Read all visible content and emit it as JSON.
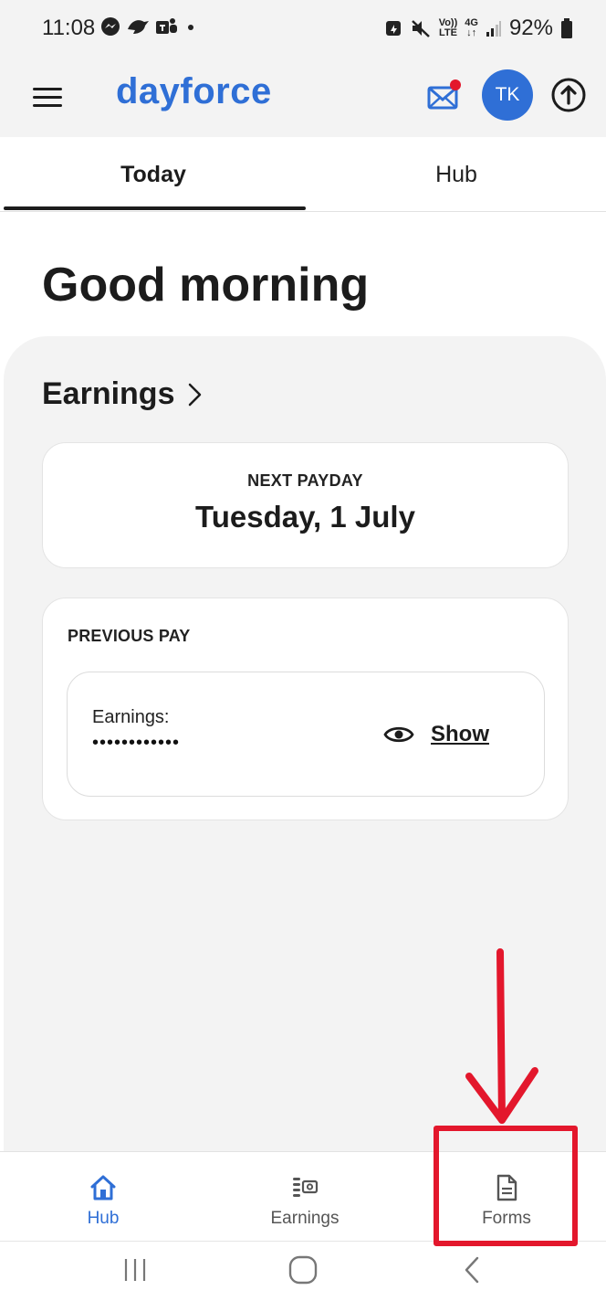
{
  "status_bar": {
    "time": "11:08",
    "left_icons": [
      "messenger-icon",
      "bird-icon",
      "teams-icon",
      "dot-icon"
    ],
    "volte_label_top": "Vo))",
    "volte_label_bottom": "LTE",
    "network_label": "4G",
    "battery_percent": "92%"
  },
  "header": {
    "brand": "dayforce",
    "avatar_initials": "TK",
    "has_unread_mail": true
  },
  "tabs": [
    {
      "label": "Today",
      "active": true
    },
    {
      "label": "Hub",
      "active": false
    }
  ],
  "main": {
    "greeting": "Good morning",
    "earnings_heading": "Earnings",
    "next_payday": {
      "label": "NEXT PAYDAY",
      "date": "Tuesday, 1 July"
    },
    "previous_pay": {
      "label": "PREVIOUS PAY",
      "earnings_label": "Earnings:",
      "masked_value": "••••••••••••",
      "show_label": "Show"
    }
  },
  "bottom_nav": [
    {
      "label": "Hub",
      "icon": "home-icon",
      "active": true
    },
    {
      "label": "Earnings",
      "icon": "earnings-icon",
      "active": false
    },
    {
      "label": "Forms",
      "icon": "document-icon",
      "active": false
    }
  ],
  "colors": {
    "brand": "#2f6fd6",
    "annotation": "#e3172c",
    "text": "#1c1c1c",
    "panel_bg": "#f3f3f3"
  }
}
